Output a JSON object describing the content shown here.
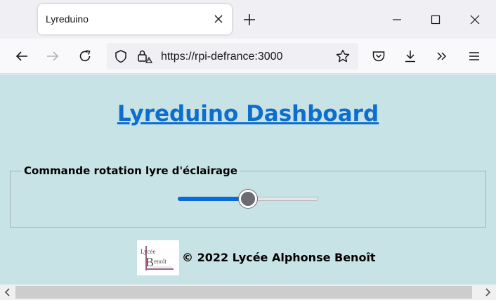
{
  "browser": {
    "tab_title": "Lyreduino",
    "url": "https://rpi-defrance:3000"
  },
  "page": {
    "title": "Lyreduino Dashboard",
    "control_legend": "Commande rotation lyre d'éclairage",
    "slider_value_fraction": 0.5,
    "footer_text": "© 2022 Lycée Alphonse Benoît",
    "logo_text": "Lycée Benoît"
  },
  "colors": {
    "content_bg": "#c8e3e5",
    "title_link": "#0d6ecd",
    "slider_fill": "#0a6ad8",
    "logo_accent": "#7a2e5a"
  },
  "icons": [
    "close-icon",
    "plus-icon",
    "minimize-icon",
    "maximize-icon",
    "window-close-icon",
    "back-arrow-icon",
    "forward-arrow-icon",
    "reload-icon",
    "shield-icon",
    "lock-icon",
    "star-icon",
    "pocket-icon",
    "download-icon",
    "overflow-chevron-icon",
    "menu-icon",
    "scroll-left-icon",
    "scroll-right-icon"
  ]
}
